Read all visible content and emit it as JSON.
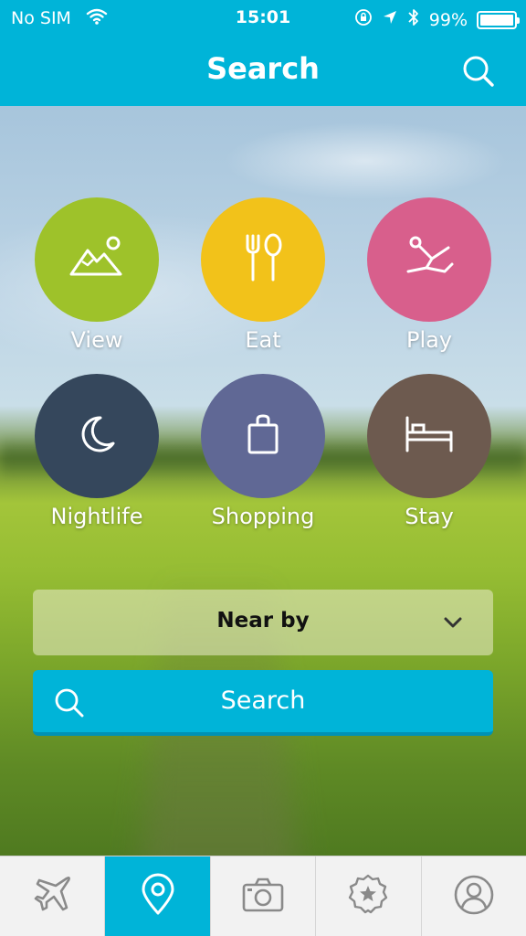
{
  "status_bar": {
    "carrier": "No SIM",
    "time": "15:01",
    "battery_percent_label": "99%",
    "battery_level": 0.99
  },
  "nav": {
    "title": "Search"
  },
  "categories": [
    {
      "label": "View",
      "color": "#9ec22a",
      "icon": "mountain-icon"
    },
    {
      "label": "Eat",
      "color": "#f2c21a",
      "icon": "fork-spoon-icon"
    },
    {
      "label": "Play",
      "color": "#d85f8c",
      "icon": "jumping-person-icon"
    },
    {
      "label": "Nightlife",
      "color": "#35475c",
      "icon": "moon-icon"
    },
    {
      "label": "Shopping",
      "color": "#606895",
      "icon": "shopping-bag-icon"
    },
    {
      "label": "Stay",
      "color": "#6d5a4f",
      "icon": "bed-icon"
    }
  ],
  "filter": {
    "selected": "Near by"
  },
  "search_button": {
    "label": "Search"
  },
  "tabs": [
    {
      "icon": "airplane-icon",
      "active": false
    },
    {
      "icon": "map-pin-icon",
      "active": true
    },
    {
      "icon": "camera-icon",
      "active": false
    },
    {
      "icon": "star-badge-icon",
      "active": false
    },
    {
      "icon": "profile-icon",
      "active": false
    }
  ],
  "colors": {
    "accent": "#00b4d8",
    "tab_icon": "#8a8a8a"
  }
}
